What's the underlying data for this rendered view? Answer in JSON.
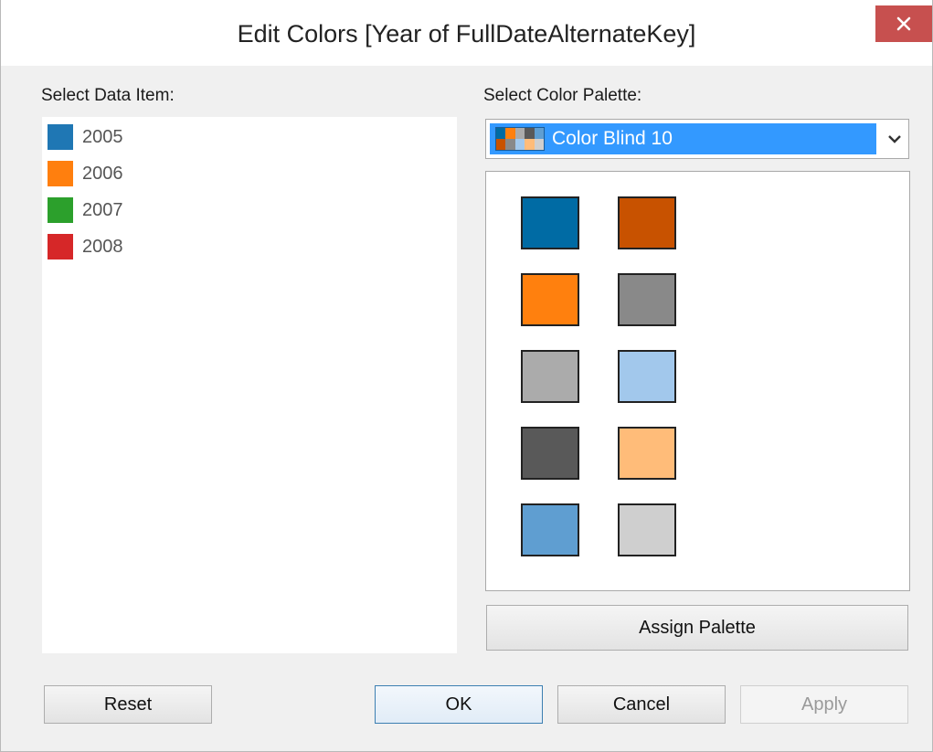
{
  "window": {
    "title": "Edit Colors [Year of FullDateAlternateKey]",
    "close_label": "×"
  },
  "left": {
    "label": "Select Data Item:",
    "items": [
      {
        "label": "2005",
        "color": "#1f77b4"
      },
      {
        "label": "2006",
        "color": "#ff7f0e"
      },
      {
        "label": "2007",
        "color": "#2ca02c"
      },
      {
        "label": "2008",
        "color": "#d62728"
      }
    ]
  },
  "right": {
    "label": "Select Color Palette:",
    "selected_palette": "Color Blind 10",
    "swatches": [
      "#006ba4",
      "#c85200",
      "#ff800e",
      "#898989",
      "#ababab",
      "#a2c8ec",
      "#595959",
      "#ffbc79",
      "#5f9ed1",
      "#cfcfcf"
    ],
    "assign_label": "Assign Palette"
  },
  "buttons": {
    "reset": "Reset",
    "ok": "OK",
    "cancel": "Cancel",
    "apply": "Apply"
  }
}
